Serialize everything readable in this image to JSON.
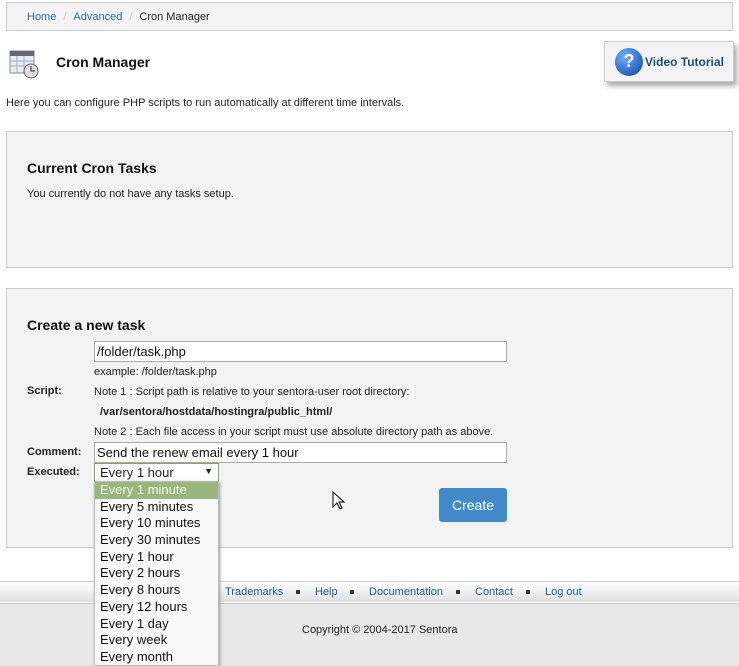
{
  "breadcrumb": [
    "Home",
    "Advanced",
    "Cron Manager"
  ],
  "page": {
    "title": "Cron Manager",
    "video_tutorial": "Video Tutorial",
    "description": "Here you can configure PHP scripts to run automatically at different time intervals."
  },
  "current": {
    "title": "Current Cron Tasks",
    "empty": "You currently do not have any tasks setup."
  },
  "create": {
    "title": "Create a new task",
    "script_label": "Script:",
    "script_value": "/folder/task.php",
    "example": "example: /folder/task.php",
    "note1": "Note 1 : Script path is relative to your sentora-user root directory:",
    "root_path": "/var/sentora/hostdata/hostingra/public_html/",
    "note2": "Note 2 : Each file access in your script must use absolute directory path as above.",
    "comment_label": "Comment:",
    "comment_value": "Send the renew email every 1 hour",
    "executed_label": "Executed:",
    "executed_value": "Every 1 hour",
    "options": [
      "Every 1 minute",
      "Every 5 minutes",
      "Every 10 minutes",
      "Every 30 minutes",
      "Every 1 hour",
      "Every 2 hours",
      "Every 8 hours",
      "Every 12 hours",
      "Every 1 day",
      "Every week",
      "Every month"
    ],
    "highlighted_option": "Every 1 minute",
    "create_button": "Create"
  },
  "footer": {
    "links": [
      "Trademarks",
      "Help",
      "Documentation",
      "Contact",
      "Log out"
    ],
    "copyright": "Copyright © 2004-2017 Sentora"
  },
  "colors": {
    "accent": "#428bca",
    "highlight": "#9ab67a",
    "link": "#2a6a99"
  }
}
